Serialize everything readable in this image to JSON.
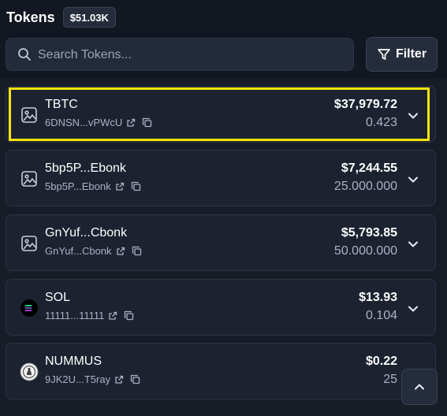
{
  "header": {
    "title": "Tokens",
    "total_value": "$51.03K"
  },
  "search": {
    "placeholder": "Search Tokens..."
  },
  "filter": {
    "label": "Filter"
  },
  "tokens": [
    {
      "name": "TBTC",
      "address": "6DNSN...vPWcU",
      "usd": "$37,979.72",
      "amount": "0.423",
      "icon": "image-placeholder-icon",
      "selected": true
    },
    {
      "name": "5bp5P...Ebonk",
      "address": "5bp5P...Ebonk",
      "usd": "$7,244.55",
      "amount": "25.000.000",
      "icon": "image-placeholder-icon"
    },
    {
      "name": "GnYuf...Cbonk",
      "address": "GnYuf...Cbonk",
      "usd": "$5,793.85",
      "amount": "50.000.000",
      "icon": "image-placeholder-icon"
    },
    {
      "name": "SOL",
      "address": "11111...11111",
      "usd": "$13.93",
      "amount": "0.104",
      "icon": "solana-logo-icon"
    },
    {
      "name": "NUMMUS",
      "address": "9JK2U...T5ray",
      "usd": "$0.22",
      "amount": "25",
      "icon": "nummus-logo-icon"
    }
  ],
  "colors": {
    "highlight": "#f5e50c",
    "background": "#131721",
    "card": "#1c2230"
  }
}
